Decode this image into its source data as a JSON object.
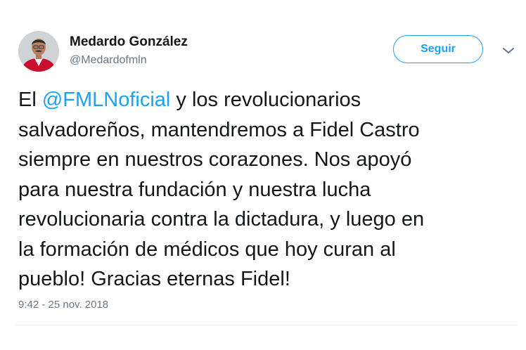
{
  "author": {
    "display_name": "Medardo González",
    "handle": "@Medardofmln"
  },
  "follow_button": {
    "label": "Seguir"
  },
  "tweet": {
    "lines": [
      {
        "before": "El ",
        "mention": "@FMLNoficial",
        "after": " y los revolucionarios"
      },
      {
        "text": "salvadoreños, mantendremos a Fidel Castro"
      },
      {
        "text": "siempre en nuestros corazones. Nos apoyó"
      },
      {
        "text": "para nuestra fundación y nuestra lucha"
      },
      {
        "text": "revolucionaria contra la dictadura, y luego en"
      },
      {
        "text": "la formación de médicos que hoy curan al"
      },
      {
        "text": "pueblo! Gracias eternas Fidel!"
      }
    ],
    "timestamp": "9:42 - 25 nov. 2018"
  },
  "icons": {
    "avatar": "profile-photo",
    "menu": "chevron-down-icon"
  },
  "colors": {
    "accent": "#1da1f2",
    "text": "#14171a",
    "secondary_text": "#657786",
    "divider": "#e6ecf0"
  }
}
